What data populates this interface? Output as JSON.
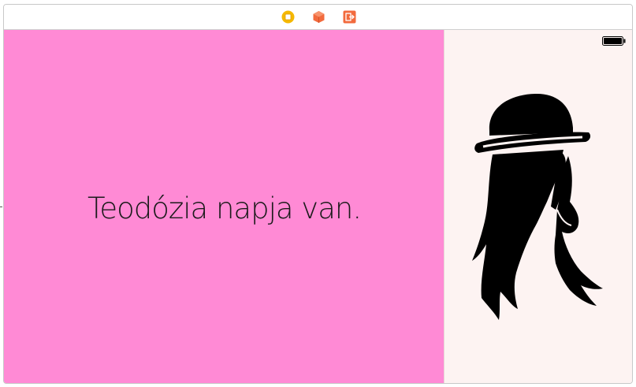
{
  "scene": {
    "message": "Teodózia napja van.",
    "colors": {
      "left_panel": "#ff8ad5",
      "right_panel": "#fdf3f2",
      "silhouette": "#000000"
    }
  },
  "dock": {
    "icons": [
      "view-controller-icon",
      "first-responder-icon",
      "exit-icon"
    ]
  },
  "status_bar": {
    "icon": "battery-icon"
  },
  "image": {
    "icon": "woman-hat-silhouette-icon"
  }
}
